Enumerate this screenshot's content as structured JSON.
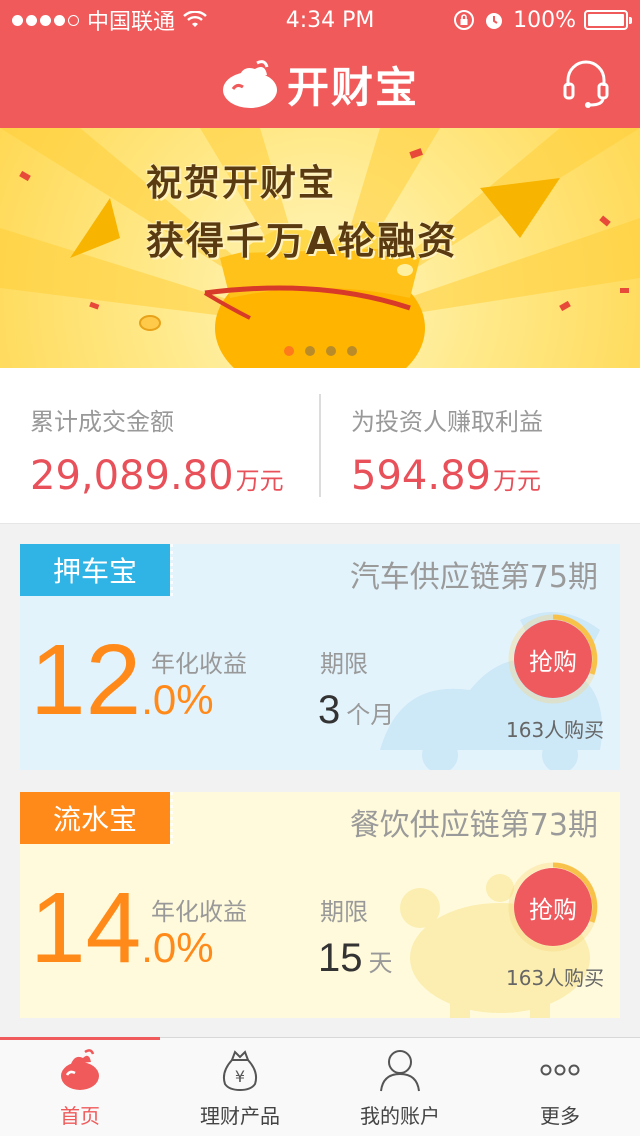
{
  "status_bar": {
    "carrier": "中国联通",
    "time": "4:34 PM",
    "battery": "100%"
  },
  "header": {
    "brand": "开财宝"
  },
  "banner": {
    "line1": "祝贺开财宝",
    "line2": "获得千万A轮融资",
    "slides": 4,
    "active_slide": 1
  },
  "stats": {
    "total_label": "累计成交金额",
    "total_value": "29,089.80",
    "total_unit": "万元",
    "earn_label": "为投资人赚取利益",
    "earn_value": "594.89",
    "earn_unit": "万元"
  },
  "products": [
    {
      "tag": "押车宝",
      "title": "汽车供应链第75期",
      "rate_int": "12",
      "rate_dec": ".0%",
      "rate_label": "年化收益",
      "term_label": "期限",
      "term_value": "3",
      "term_unit": "个月",
      "button": "抢购",
      "buyers": "163人购买",
      "progress": 0.3
    },
    {
      "tag": "流水宝",
      "title": "餐饮供应链第73期",
      "rate_int": "14",
      "rate_dec": ".0%",
      "rate_label": "年化收益",
      "term_label": "期限",
      "term_value": "15",
      "term_unit": "天",
      "button": "抢购",
      "buyers": "163人购买",
      "progress": 0.3
    }
  ],
  "tabbar": {
    "home": "首页",
    "products": "理财产品",
    "account": "我的账户",
    "more": "更多"
  },
  "colors": {
    "brand_red": "#f05a5a",
    "accent_orange": "#ff8a1a",
    "tag_blue": "#30b4e6"
  }
}
